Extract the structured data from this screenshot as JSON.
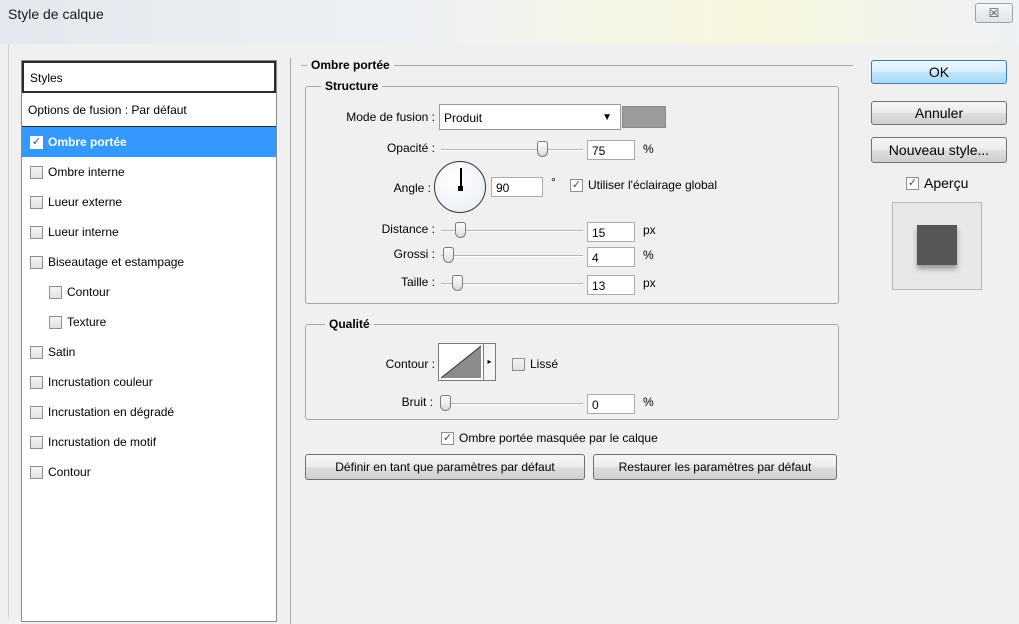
{
  "window": {
    "title": "Style de calque",
    "close_glyph": "☒"
  },
  "sidebar": {
    "header": "Styles",
    "blend_options": "Options de fusion : Par défaut",
    "items": [
      {
        "label": "Ombre portée",
        "checked": true,
        "selected": true
      },
      {
        "label": "Ombre interne",
        "checked": false
      },
      {
        "label": "Lueur externe",
        "checked": false
      },
      {
        "label": "Lueur interne",
        "checked": false
      },
      {
        "label": "Biseautage et estampage",
        "checked": false
      },
      {
        "label": "Contour",
        "checked": false,
        "sub": true
      },
      {
        "label": "Texture",
        "checked": false,
        "sub": true
      },
      {
        "label": "Satin",
        "checked": false
      },
      {
        "label": "Incrustation couleur",
        "checked": false
      },
      {
        "label": "Incrustation en dégradé",
        "checked": false
      },
      {
        "label": "Incrustation de motif",
        "checked": false
      },
      {
        "label": "Contour",
        "checked": false
      }
    ]
  },
  "drop_shadow": {
    "section_title": "Ombre portée",
    "structure": {
      "title": "Structure",
      "blend_mode_label": "Mode de fusion :",
      "blend_mode_value": "Produit",
      "shadow_color": "#9b9b9b",
      "opacity_label": "Opacité :",
      "opacity_value": "75",
      "opacity_unit": "%",
      "opacity_level": 0.75,
      "angle_label": "Angle :",
      "angle_value": "90",
      "angle_unit": "°",
      "use_global_light_label": "Utiliser l'éclairage global",
      "use_global_light_checked": true,
      "distance_label": "Distance :",
      "distance_value": "15",
      "distance_unit": "px",
      "spread_label": "Grossi :",
      "spread_value": "4",
      "spread_unit": "%",
      "size_label": "Taille :",
      "size_value": "13",
      "size_unit": "px"
    },
    "quality": {
      "title": "Qualité",
      "contour_label": "Contour :",
      "antialias_label": "Lissé",
      "antialias_checked": false,
      "noise_label": "Bruit :",
      "noise_value": "0",
      "noise_unit": "%"
    },
    "knockout_label": "Ombre portée masquée par le calque",
    "knockout_checked": true,
    "make_default_label": "Définir en tant que paramètres par défaut",
    "reset_default_label": "Restaurer les paramètres par défaut"
  },
  "buttons": {
    "ok": "OK",
    "cancel": "Annuler",
    "new_style": "Nouveau style...",
    "preview_label": "Aperçu",
    "preview_checked": true
  },
  "icons": {
    "check": "✓",
    "dropdown": "▼",
    "contour_arrow": "▸"
  }
}
